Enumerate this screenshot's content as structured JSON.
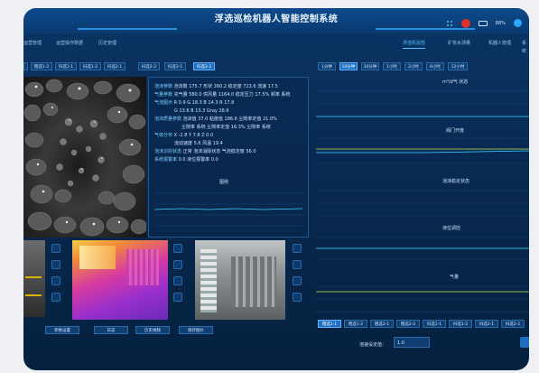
{
  "header": {
    "title": "浮选巡检机器人智能控制系统",
    "battery_text": "88%",
    "colors": {
      "accent": "#2aa6ff",
      "alert": "#e0302b"
    }
  },
  "nav_left": [
    "运营管理",
    "运营操作数据",
    "历史管理"
  ],
  "nav_right": [
    {
      "label": "浮选机巡检",
      "active": true
    },
    {
      "label": "矿浆水测量",
      "active": false
    },
    {
      "label": "机器人管理",
      "active": false
    },
    {
      "label": "系统",
      "active": false
    }
  ],
  "cam_tabs": [
    {
      "label": "粗选1-2",
      "active": false
    },
    {
      "label": "扫选1-1",
      "active": false
    },
    {
      "label": "扫选1-2",
      "active": false
    },
    {
      "label": "扫选2-1",
      "active": false
    },
    {
      "label": "扫选2-2",
      "active": false
    },
    {
      "label": "扫选3-1",
      "active": false
    },
    {
      "label": "扫选3-2",
      "active": true
    }
  ],
  "info": {
    "rows": [
      {
        "label": "泡沫参数",
        "text": "泡沫数  175.7  形状  260.2  稳定度  723.6  流速  17.5"
      },
      {
        "label": "气量参数",
        "text": "充气量  580.0  供风量  1164.0  稳定压力  17.5%  频率  系统"
      },
      {
        "label": "气泡图示",
        "text": "R  0.9     G  18.3     B  14.3     R  17.8"
      },
      {
        "label": "",
        "text": "G  13.6     B  13.3     Gray  28.6"
      },
      {
        "label": "泡沫质量参数",
        "text": "泡沫值  37.0  粘度值  186.6  尘隙率定值  21.0%"
      },
      {
        "label": "",
        "text": "尘隙率  系统   尘隙率定值  16.3%   尘隙率  系统"
      },
      {
        "label": "气体分布",
        "text": "X  -2.8     Y  7.8     Z  0.0"
      },
      {
        "label": "",
        "text": "流动速度  5.6     风温  19.4"
      },
      {
        "label": "泡沫识别状态",
        "text": "正常    泡沫消除状态     气泡稳定度  56.0"
      },
      {
        "label": "系统报警率",
        "text": "0.0    液位报警率  0.0"
      }
    ],
    "chart_label": "图例"
  },
  "side_buttons": [
    "参数设置",
    "日志",
    "历史视频",
    "保存图片"
  ],
  "time_tabs": [
    {
      "label": "1分钟",
      "active": false
    },
    {
      "label": "10分钟",
      "active": true
    },
    {
      "label": "30分钟",
      "active": false
    },
    {
      "label": "1小时",
      "active": false
    },
    {
      "label": "2小时",
      "active": false
    },
    {
      "label": "6小时",
      "active": false
    },
    {
      "label": "12小时",
      "active": false
    }
  ],
  "charts": [
    {
      "title": "m³/d气 状态"
    },
    {
      "title": "阀门开度"
    },
    {
      "title": "泡沫稳定状态"
    },
    {
      "title": "液位调控"
    },
    {
      "title": "气量"
    }
  ],
  "bottom_tabs": [
    {
      "label": "粗选1-1",
      "active": true
    },
    {
      "label": "粗选1-2",
      "active": false
    },
    {
      "label": "粗选2-1",
      "active": false
    },
    {
      "label": "粗选2-2",
      "active": false
    },
    {
      "label": "扫选1-1",
      "active": false
    },
    {
      "label": "扫选1-2",
      "active": false
    },
    {
      "label": "扫选2-1",
      "active": false
    },
    {
      "label": "扫选2-2",
      "active": false
    }
  ],
  "setting": {
    "label": "泡速设定值：",
    "value": "1.0"
  }
}
